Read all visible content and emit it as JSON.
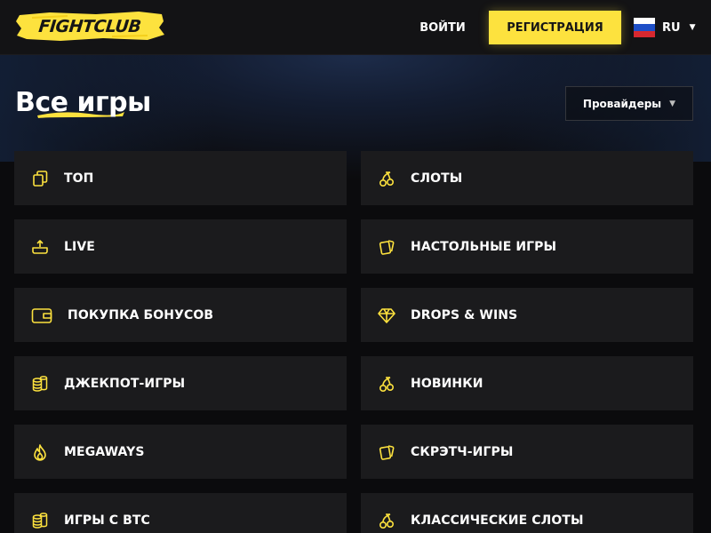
{
  "brand": {
    "logo_text": "FIGHTCLUB",
    "accent_color": "#fde23e"
  },
  "header": {
    "login_label": "ВОЙТИ",
    "register_label": "РЕГИСТРАЦИЯ",
    "language": {
      "code": "RU",
      "flag": "russia-flag-icon"
    }
  },
  "page": {
    "title": "Все игры",
    "providers_label": "Провайдеры"
  },
  "categories": {
    "left": [
      {
        "label": "ТОП",
        "icon": "cards-stack-icon"
      },
      {
        "label": "LIVE",
        "icon": "live-table-icon"
      },
      {
        "label": "ПОКУПКА БОНУСОВ",
        "icon": "wallet-icon"
      },
      {
        "label": "ДЖЕКПОТ-ИГРЫ",
        "icon": "coin-stack-icon"
      },
      {
        "label": "MEGAWAYS",
        "icon": "flame-icon"
      },
      {
        "label": "ИГРЫ С BTC",
        "icon": "coin-stack-icon"
      }
    ],
    "right": [
      {
        "label": "СЛОТЫ",
        "icon": "cherries-icon"
      },
      {
        "label": "НАСТОЛЬНЫЕ ИГРЫ",
        "icon": "playing-cards-icon"
      },
      {
        "label": "DROPS & WINS",
        "icon": "diamond-icon"
      },
      {
        "label": "НОВИНКИ",
        "icon": "cherries-icon"
      },
      {
        "label": "СКРЭТЧ-ИГРЫ",
        "icon": "playing-cards-icon"
      },
      {
        "label": "КЛАССИЧЕСКИЕ СЛОТЫ",
        "icon": "cherries-icon"
      }
    ]
  }
}
